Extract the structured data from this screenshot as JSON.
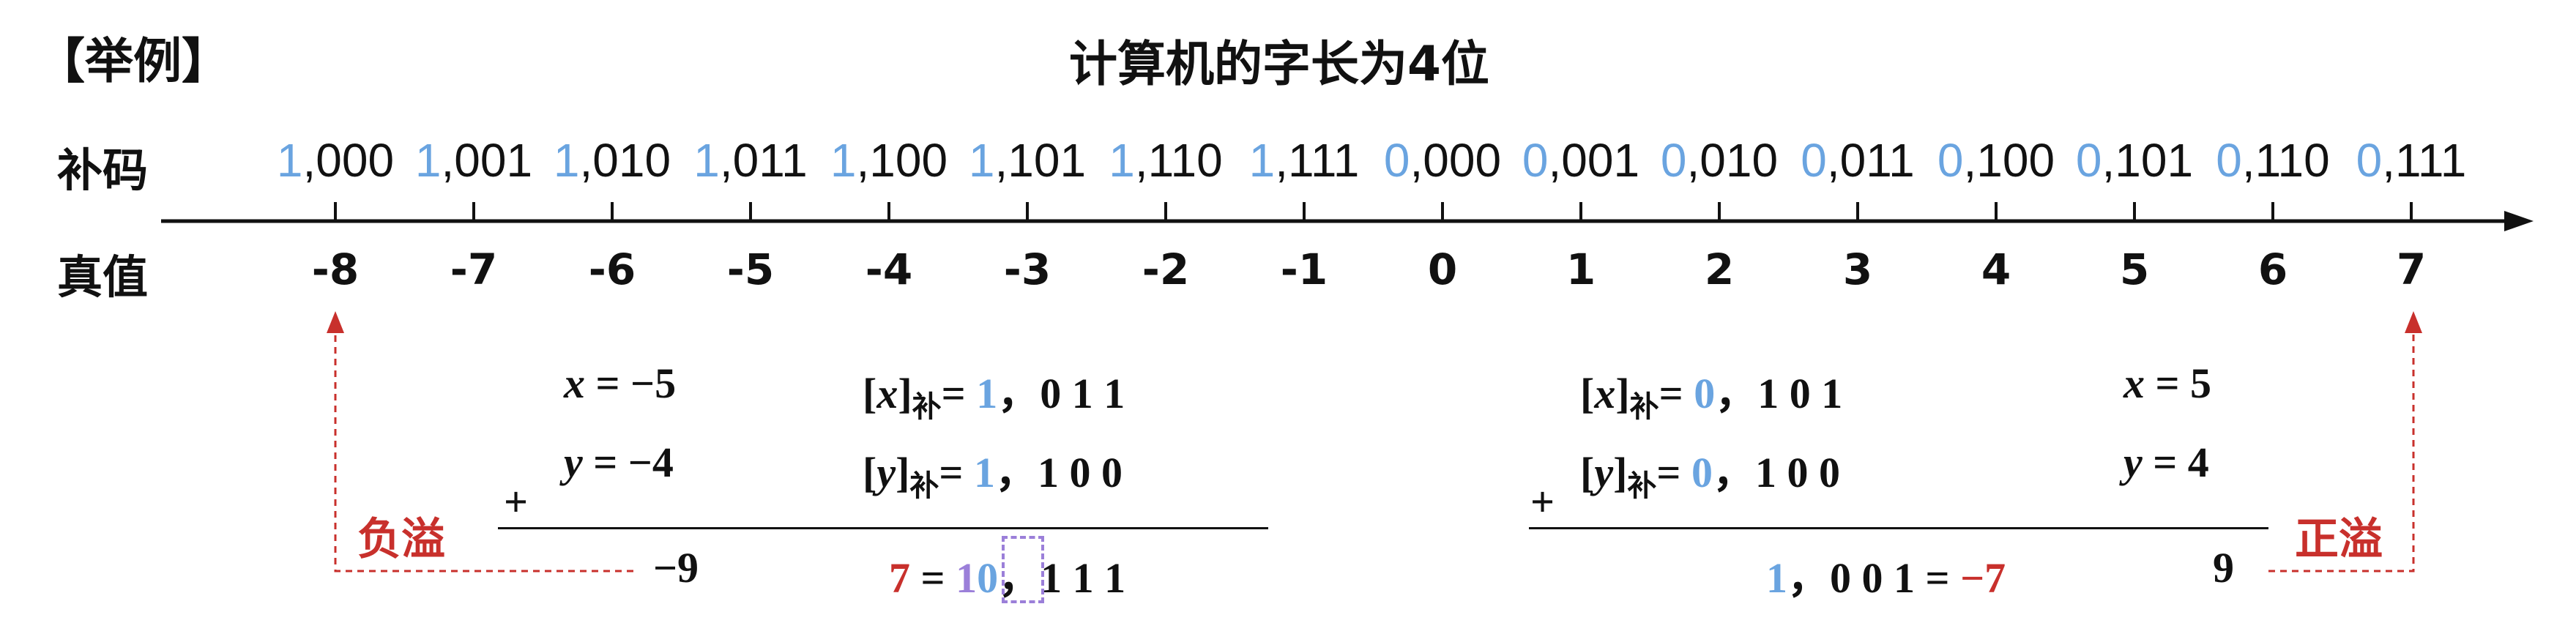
{
  "header": {
    "example_label": "【举例】",
    "title": "计算机的字长为4位"
  },
  "axis": {
    "code_label": "补码",
    "value_label": "真值",
    "items": [
      {
        "sign": "1",
        "rest": ",000",
        "value": "-8"
      },
      {
        "sign": "1",
        "rest": ",001",
        "value": "-7"
      },
      {
        "sign": "1",
        "rest": ",010",
        "value": "-6"
      },
      {
        "sign": "1",
        "rest": ",011",
        "value": "-5"
      },
      {
        "sign": "1",
        "rest": ",100",
        "value": "-4"
      },
      {
        "sign": "1",
        "rest": ",101",
        "value": "-3"
      },
      {
        "sign": "1",
        "rest": ",110",
        "value": "-2"
      },
      {
        "sign": "1",
        "rest": ",111",
        "value": "-1"
      },
      {
        "sign": "0",
        "rest": ",000",
        "value": "0"
      },
      {
        "sign": "0",
        "rest": ",001",
        "value": "1"
      },
      {
        "sign": "0",
        "rest": ",010",
        "value": "2"
      },
      {
        "sign": "0",
        "rest": ",011",
        "value": "3"
      },
      {
        "sign": "0",
        "rest": ",100",
        "value": "4"
      },
      {
        "sign": "0",
        "rest": ",101",
        "value": "5"
      },
      {
        "sign": "0",
        "rest": ",110",
        "value": "6"
      },
      {
        "sign": "0",
        "rest": ",111",
        "value": "7"
      }
    ]
  },
  "left": {
    "x_var": "x",
    "x_val": " = −5",
    "y_var": "y",
    "y_val": " = −4",
    "xc_open": "[",
    "xc_var": "x",
    "xc_close": "]",
    "xc_sub": "补",
    "xc_eq": "= ",
    "xc_sign": "1",
    "xc_rest": "，0 1 1",
    "yc_open": "[",
    "yc_var": "y",
    "yc_close": "]",
    "yc_sub": "补",
    "yc_eq": "= ",
    "yc_sign": "1",
    "yc_rest": "，1 0 0",
    "plus": "+",
    "sum_val": "−9",
    "res_val": "7",
    "res_eq": " = ",
    "res_carry": "1",
    "res_sign": "0",
    "res_rest": "，1 1 1",
    "overflow": "负溢"
  },
  "right": {
    "xc_open": "[",
    "xc_var": "x",
    "xc_close": "]",
    "xc_sub": "补",
    "xc_eq": "= ",
    "xc_sign": "0",
    "xc_rest": "，1 0 1",
    "yc_open": "[",
    "yc_var": "y",
    "yc_close": "]",
    "yc_sub": "补",
    "yc_eq": "= ",
    "yc_sign": "0",
    "yc_rest": "，1 0 0",
    "x_var": "x",
    "x_val": " = 5",
    "y_var": "y",
    "y_val": " = 4",
    "plus": "+",
    "res_sign": "1",
    "res_rest": "，0 0 1 = ",
    "res_val": "−7",
    "sum_val": "9",
    "overflow": "正溢"
  },
  "colors": {
    "sign_bit": "#6aa4e0",
    "overflow": "#c8302c",
    "carry_box": "#9b7fd9"
  }
}
